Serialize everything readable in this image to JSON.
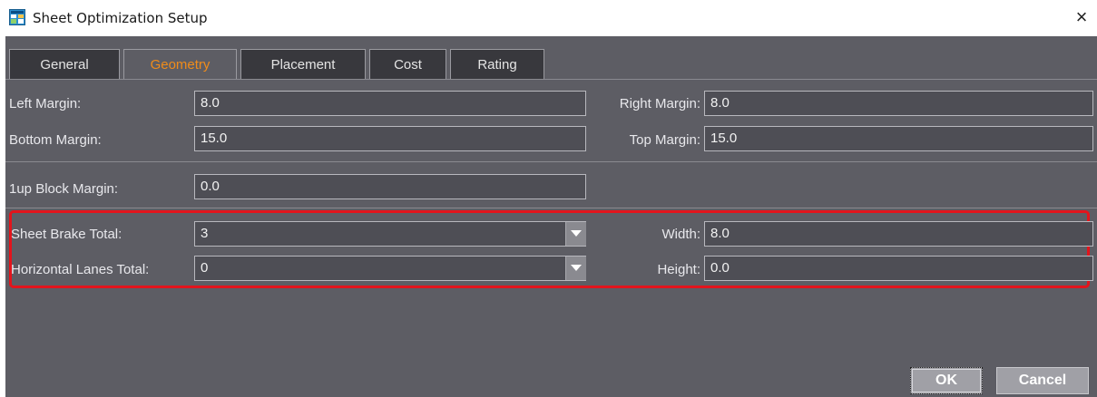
{
  "window": {
    "title": "Sheet Optimization Setup",
    "close_glyph": "×",
    "icon": "sheet-setup-icon"
  },
  "tabs": [
    {
      "label": "General",
      "active": false
    },
    {
      "label": "Geometry",
      "active": true
    },
    {
      "label": "Placement",
      "active": false
    },
    {
      "label": "Cost",
      "active": false
    },
    {
      "label": "Rating",
      "active": false
    }
  ],
  "accent_color": "#f08c1a",
  "highlight_color": "#e3141c",
  "fields": {
    "left_margin": {
      "label": "Left Margin:",
      "value": "8.0"
    },
    "right_margin": {
      "label": "Right Margin:",
      "value": "8.0"
    },
    "bottom_margin": {
      "label": "Bottom Margin:",
      "value": "15.0"
    },
    "top_margin": {
      "label": "Top Margin:",
      "value": "15.0"
    },
    "block_margin": {
      "label": "1up Block Margin:",
      "value": "0.0"
    },
    "sheet_brake_total": {
      "label": "Sheet Brake Total:",
      "value": "3"
    },
    "horizontal_lanes_total": {
      "label": "Horizontal Lanes Total:",
      "value": "0"
    },
    "width": {
      "label": "Width:",
      "value": "8.0"
    },
    "height": {
      "label": "Height:",
      "value": "0.0"
    }
  },
  "buttons": {
    "ok": "OK",
    "cancel": "Cancel"
  }
}
